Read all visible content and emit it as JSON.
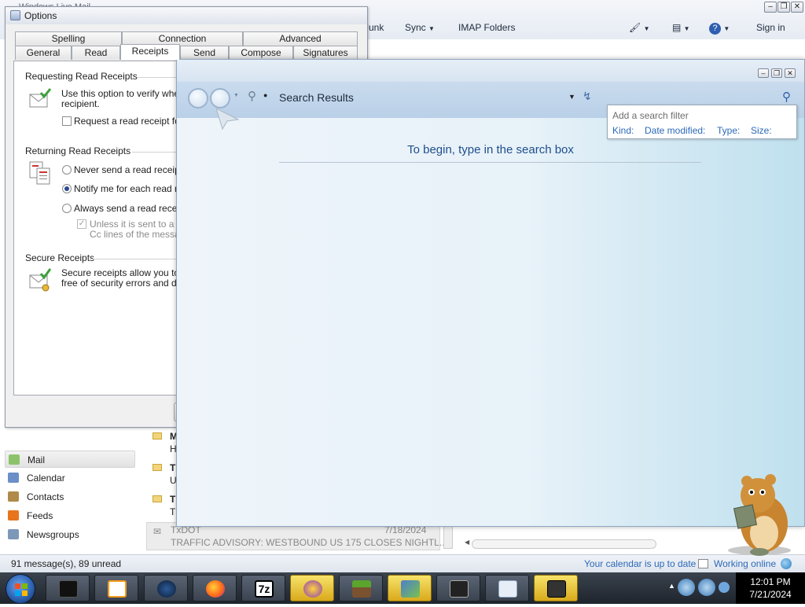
{
  "mail_app": {
    "title": "Windows Live Mail",
    "toolbar": {
      "junk": "Junk",
      "sync": "Sync",
      "imap_folders": "IMAP Folders",
      "sign_in": "Sign in"
    },
    "nav": [
      "Mail",
      "Calendar",
      "Contacts",
      "Feeds",
      "Newsgroups"
    ],
    "messages": [
      {
        "a": "M",
        "b": "H"
      },
      {
        "a": "T",
        "b": "U"
      },
      {
        "a": "T",
        "b": "T"
      }
    ],
    "last_message": {
      "sender": "TxDOT",
      "date": "7/18/2024",
      "subject": "TRAFFIC ADVISORY: WESTBOUND US 175 CLOSES NIGHTL..."
    },
    "status": {
      "count": "91 message(s), 89 unread",
      "calendar": "Your calendar is up to date",
      "online": "Working online"
    }
  },
  "options_dialog": {
    "title": "Options",
    "tabs_top": [
      "Spelling",
      "Connection",
      "Advanced"
    ],
    "tabs_bottom": [
      "General",
      "Read",
      "Receipts",
      "Send",
      "Compose",
      "Signatures"
    ],
    "requesting": {
      "header": "Requesting Read Receipts",
      "line1": "Use this option to verify when a",
      "line2": "recipient.",
      "checkbox": "Request a read receipt for a"
    },
    "returning": {
      "header": "Returning Read Receipts",
      "never": "Never send a read receipt",
      "notify": "Notify me for each read rece",
      "always": "Always send a read receipt",
      "unless1": "Unless it is sent to a ma",
      "unless2": "Cc lines of the message"
    },
    "secure": {
      "header": "Secure Receipts",
      "line1": "Secure receipts allow you to ve",
      "line2": "free of security errors and displa"
    }
  },
  "search_window": {
    "location": "Search Results",
    "empty_text": "To begin, type in the search box",
    "filter": {
      "title": "Add a search filter",
      "kind": "Kind:",
      "date_modified": "Date modified:",
      "type": "Type:",
      "size": "Size:"
    }
  },
  "taskbar": {
    "time": "12:01 PM",
    "date": "7/21/2024",
    "tasks": [
      "media-icon",
      "settings-icon",
      "firefox-icon",
      "7zip-icon",
      "vpn-icon",
      "minecraft-icon",
      "mail-icon",
      "monitor-icon",
      "window-icon",
      "tablet-icon"
    ],
    "task_labels": {
      "7zip": "7z"
    }
  }
}
